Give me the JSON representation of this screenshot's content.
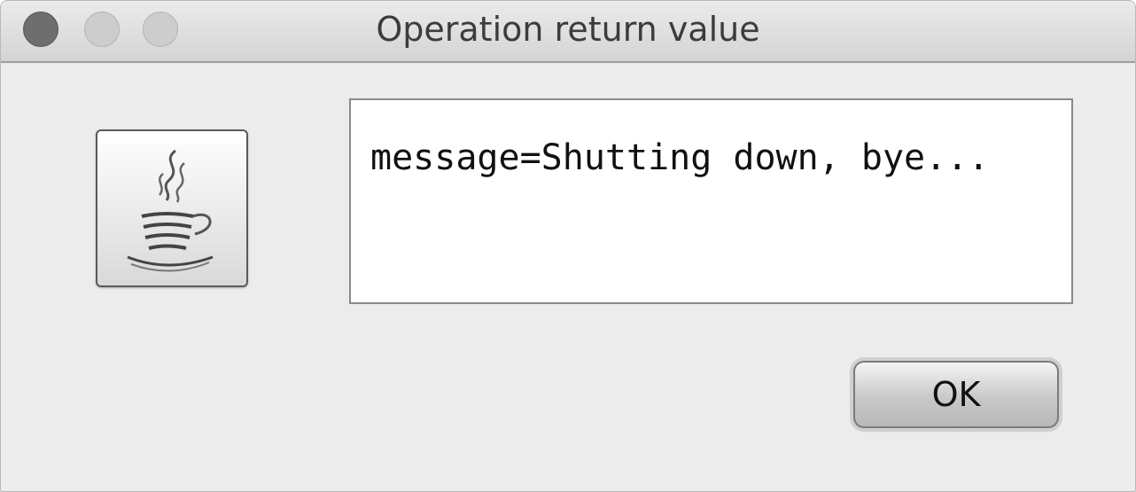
{
  "window": {
    "title": "Operation return value"
  },
  "dialog": {
    "icon": "java-coffee-cup-icon",
    "message": "message=Shutting down, bye...",
    "ok_label": "OK"
  }
}
